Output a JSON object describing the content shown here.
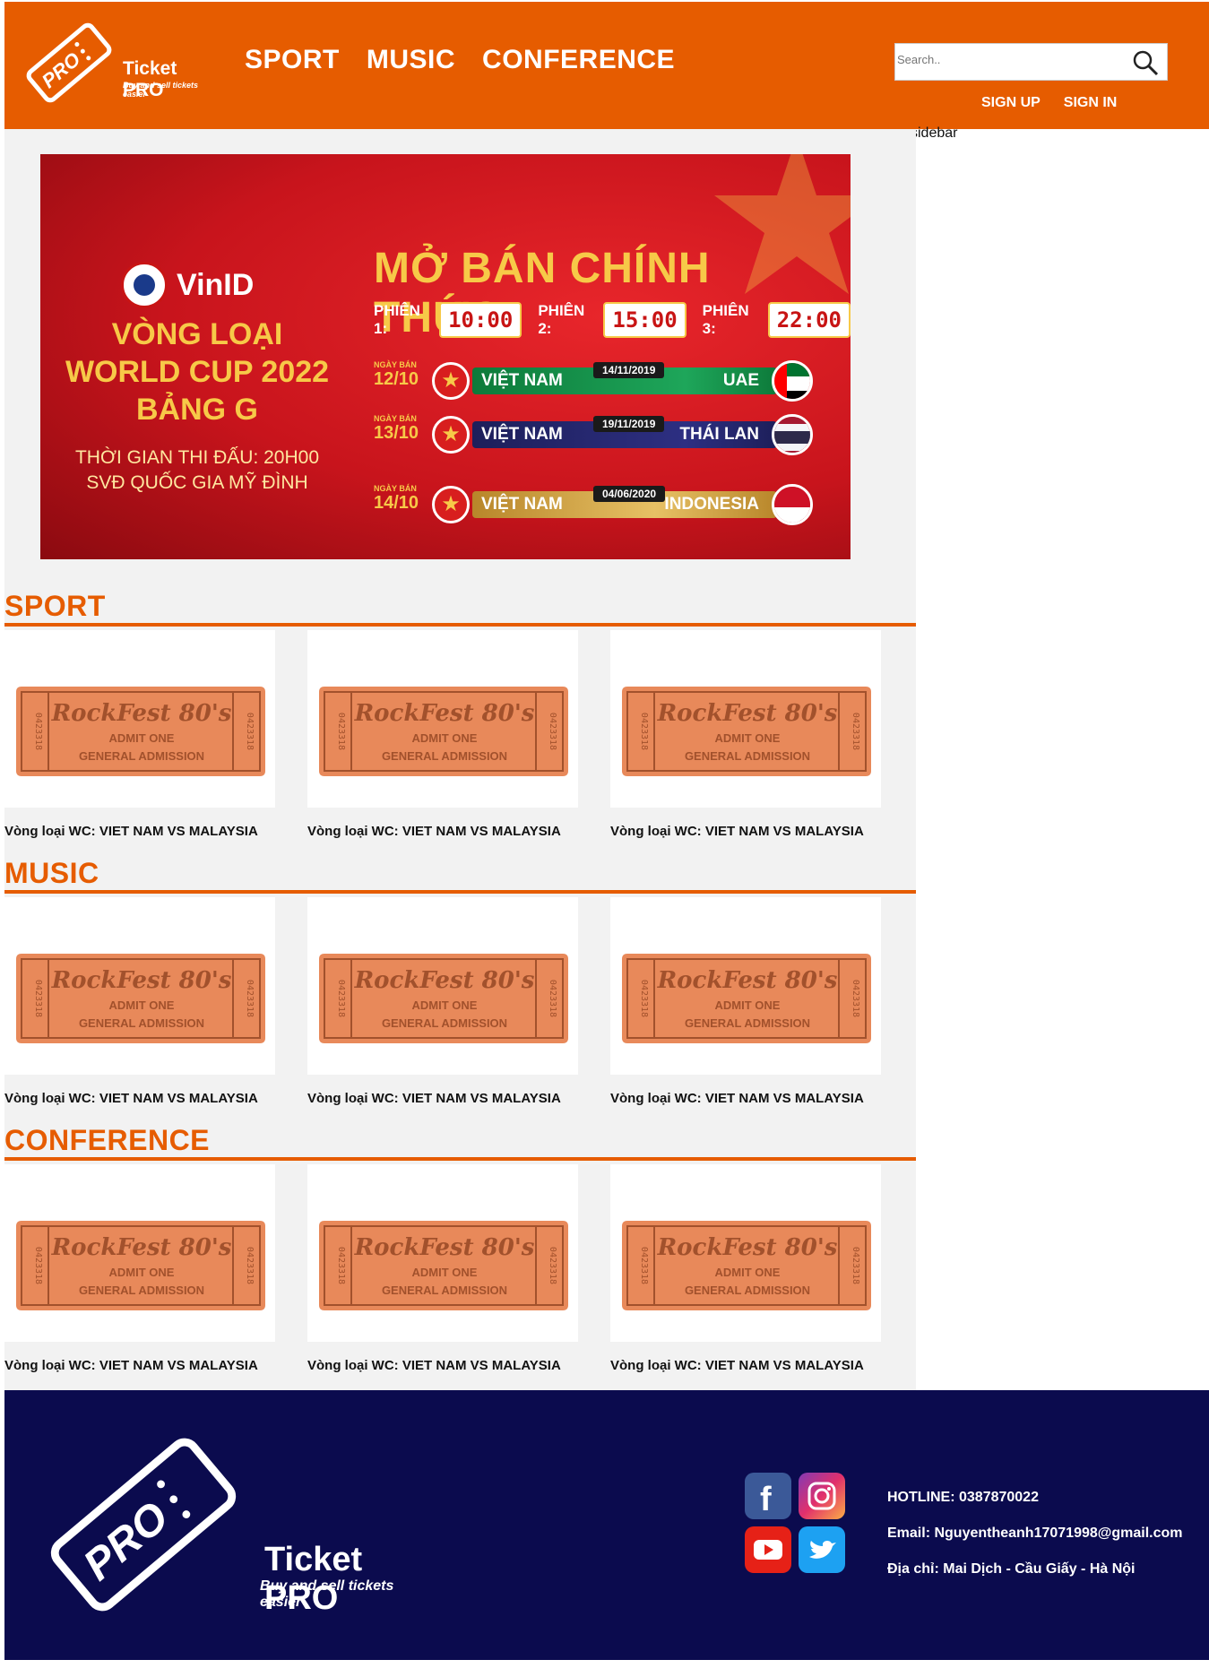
{
  "header": {
    "logo_title": "Ticket PRO",
    "logo_tagline": "Buy and sell tickets easier",
    "logo_badge": "PRO",
    "nav": [
      "SPORT",
      "MUSIC",
      "CONFERENCE"
    ],
    "search_placeholder": "Search..",
    "signup": "SIGN UP",
    "signin": "SIGN IN",
    "accent_color": "#e65c00"
  },
  "sidebar": {
    "label": "sidebar"
  },
  "banner": {
    "brand": "VinID",
    "title_lines": [
      "VÒNG LOẠI",
      "WORLD CUP 2022",
      "BẢNG G"
    ],
    "time_lines": [
      "THỜI GIAN THI ĐẤU: 20H00",
      "SVĐ QUỐC GIA MỸ ĐÌNH"
    ],
    "headline": "MỞ BÁN CHÍNH THỨC",
    "sessions": [
      {
        "label": "PHIÊN 1:",
        "time": "10:00"
      },
      {
        "label": "PHIÊN 2:",
        "time": "15:00"
      },
      {
        "label": "PHIÊN 3:",
        "time": "22:00"
      }
    ],
    "matches": [
      {
        "sale_label": "NGÀY BÁN",
        "sale_day": "12/10",
        "team1": "VIỆT NAM",
        "date": "14/11/2019",
        "team2": "UAE"
      },
      {
        "sale_label": "NGÀY BÁN",
        "sale_day": "13/10",
        "team1": "VIỆT NAM",
        "date": "19/11/2019",
        "team2": "THÁI LAN"
      },
      {
        "sale_label": "NGÀY BÁN",
        "sale_day": "14/10",
        "team1": "VIỆT NAM",
        "date": "04/06/2020",
        "team2": "INDONESIA"
      }
    ]
  },
  "ticket_art": {
    "brand": "RockFest 80's",
    "admit": "ADMIT ONE",
    "admission": "GENERAL ADMISSION",
    "serial": "0423318"
  },
  "sections": [
    {
      "title": "SPORT",
      "cards": [
        "Vòng loại WC: VIET NAM VS MALAYSIA",
        "Vòng loại WC: VIET NAM VS MALAYSIA",
        "Vòng loại WC: VIET NAM VS MALAYSIA"
      ]
    },
    {
      "title": "MUSIC",
      "cards": [
        "Vòng loại WC: VIET NAM VS MALAYSIA",
        "Vòng loại WC: VIET NAM VS MALAYSIA",
        "Vòng loại WC: VIET NAM VS MALAYSIA"
      ]
    },
    {
      "title": "CONFERENCE",
      "cards": [
        "Vòng loại WC: VIET NAM VS MALAYSIA",
        "Vòng loại WC: VIET NAM VS MALAYSIA",
        "Vòng loại WC: VIET NAM VS MALAYSIA"
      ]
    }
  ],
  "footer": {
    "logo_title": "Ticket PRO",
    "logo_tagline": "Buy and sell tickets easier",
    "social": [
      "facebook-icon",
      "instagram-icon",
      "youtube-icon",
      "twitter-icon"
    ],
    "hotline": "HOTLINE: 0387870022",
    "email": "Email: Nguyentheanh17071998@gmail.com",
    "address": "Địa chỉ: Mai Dịch - Cầu Giấy - Hà Nội",
    "bg_color": "#0b0b4e"
  }
}
